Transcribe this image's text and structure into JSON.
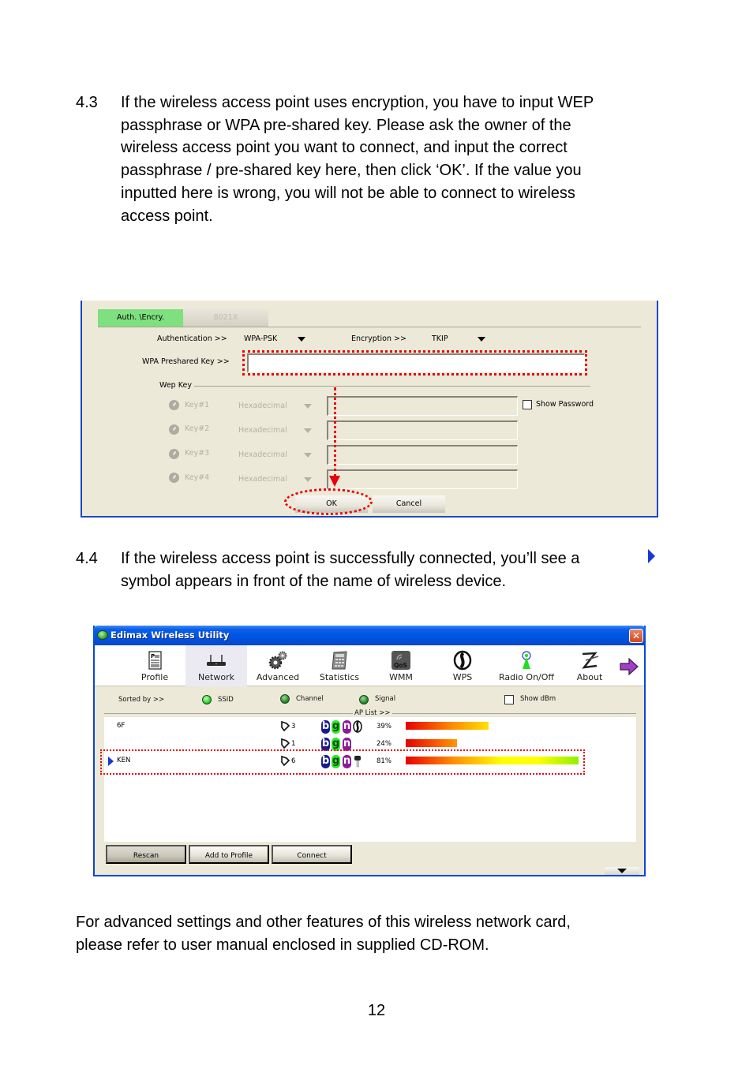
{
  "section_4_3": {
    "number": "4.3",
    "text": "If the wireless access point uses encryption, you have to input WEP\npassphrase or WPA pre-shared key. Please ask the owner of the\nwireless access point you want to connect, and input the correct\npassphrase / pre-shared key here, then click ‘OK’. If the value you\ninputted here is wrong, you will not be able to connect to wireless\naccess point."
  },
  "auth_dialog": {
    "tabs": [
      {
        "label": "Auth. \\Encry.",
        "active": true
      },
      {
        "label": "8021X",
        "active": false
      }
    ],
    "authentication_label": "Authentication >>",
    "authentication_value": "WPA-PSK",
    "encryption_label": "Encryption >>",
    "encryption_value": "TKIP",
    "wpa_key_label": "WPA Preshared Key >>",
    "wpa_key_value": "",
    "wep_group_label": "Wep Key",
    "wep_keys": [
      {
        "label": "Key#1",
        "format": "Hexadecimal",
        "value": ""
      },
      {
        "label": "Key#2",
        "format": "Hexadecimal",
        "value": ""
      },
      {
        "label": "Key#3",
        "format": "Hexadecimal",
        "value": ""
      },
      {
        "label": "Key#4",
        "format": "Hexadecimal",
        "value": ""
      }
    ],
    "show_password_label": "Show Password",
    "show_password_checked": false,
    "ok_label": "OK",
    "cancel_label": "Cancel",
    "highlight_color": "#e8000a"
  },
  "section_4_4": {
    "number": "4.4",
    "text": "If the wireless access point is successfully connected, you’ll see a\nsymbol appears in front of the name of wireless device.",
    "symbol": "blue-right-triangle"
  },
  "utility_window": {
    "title": "Edimax Wireless Utility",
    "close_glyph": "✕",
    "toolbar": [
      {
        "label": "Profile",
        "icon": "profile-icon",
        "active": false
      },
      {
        "label": "Network",
        "icon": "router-icon",
        "active": true
      },
      {
        "label": "Advanced",
        "icon": "gears-icon",
        "active": false
      },
      {
        "label": "Statistics",
        "icon": "calculator-icon",
        "active": false
      },
      {
        "label": "WMM",
        "icon": "qos-icon",
        "active": false
      },
      {
        "label": "WPS",
        "icon": "wps-icon",
        "active": false
      },
      {
        "label": "Radio On/Off",
        "icon": "antenna-icon",
        "active": false
      },
      {
        "label": "About",
        "icon": "about-icon",
        "active": false
      }
    ],
    "sorted_by_label": "Sorted by >>",
    "sort_options": [
      {
        "label": "SSID",
        "selected": true
      },
      {
        "label": "Channel",
        "selected": false
      },
      {
        "label": "Signal",
        "selected": false
      }
    ],
    "show_dbm_label": "Show dBm",
    "show_dbm_checked": false,
    "ap_list_label": "AP List >>",
    "ap_list": [
      {
        "ssid": "6F",
        "channel": "3",
        "modes": [
          "b",
          "g",
          "n"
        ],
        "extra": "wps",
        "signal": "39%",
        "signal_value": 39,
        "connected": false
      },
      {
        "ssid": "",
        "channel": "1",
        "modes": [
          "b",
          "g",
          "n"
        ],
        "extra": "",
        "signal": "24%",
        "signal_value": 24,
        "connected": false
      },
      {
        "ssid": "KEN",
        "channel": "6",
        "modes": [
          "b",
          "g",
          "n"
        ],
        "extra": "key",
        "signal": "81%",
        "signal_value": 81,
        "connected": true
      }
    ],
    "buttons": {
      "rescan": "Rescan",
      "add_to_profile": "Add to Profile",
      "connect": "Connect"
    }
  },
  "closing_text": "For advanced settings and other features of this wireless network card,\nplease refer to user manual enclosed in supplied CD-ROM.",
  "page_number": "12"
}
